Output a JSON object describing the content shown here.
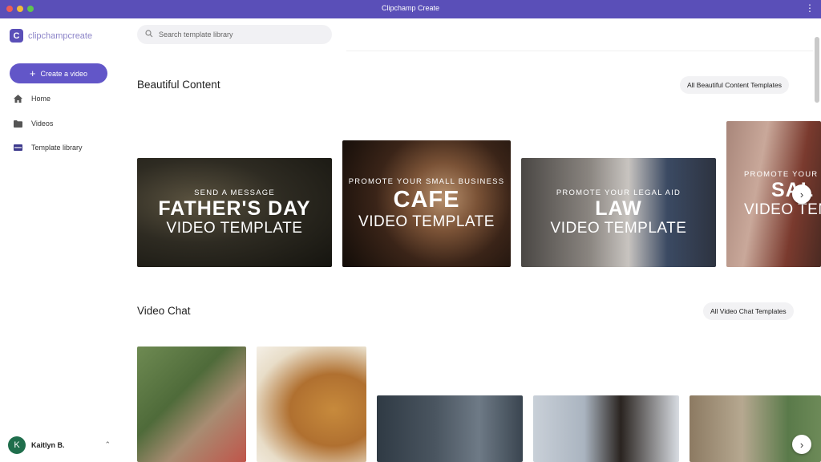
{
  "window": {
    "title": "Clipchamp Create",
    "menu_icon": "kebab-icon"
  },
  "sidebar": {
    "logo_mark": "C",
    "logo_text_main": "clipchamp",
    "logo_text_suffix": "create",
    "create_label": "Create a video",
    "items": [
      {
        "label": "Home",
        "icon": "home-icon"
      },
      {
        "label": "Videos",
        "icon": "folder-icon"
      },
      {
        "label": "Template library",
        "icon": "template-icon"
      }
    ],
    "user": {
      "initial": "K",
      "name": "Kaitlyn B.",
      "chevron": "⌃"
    }
  },
  "search": {
    "placeholder": "Search template library"
  },
  "sections": [
    {
      "title": "Beautiful Content",
      "all_label": "All Beautiful Content Templates",
      "cards": [
        {
          "small": "SEND A MESSAGE",
          "big": "FATHER'S DAY",
          "mid": "VIDEO TEMPLATE"
        },
        {
          "small": "PROMOTE YOUR SMALL BUSINESS",
          "big": "CAFE",
          "mid": "VIDEO TEMPLATE"
        },
        {
          "small": "PROMOTE YOUR LEGAL AID",
          "big": "LAW",
          "mid": "VIDEO TEMPLATE"
        },
        {
          "small": "PROMOTE YOUR WIN",
          "big": "SAL",
          "mid": "VIDEO TEMP"
        }
      ]
    },
    {
      "title": "Video Chat",
      "all_label": "All Video Chat Templates"
    }
  ],
  "colors": {
    "accent": "#6256c8",
    "titlebar": "#5a4fb8"
  }
}
